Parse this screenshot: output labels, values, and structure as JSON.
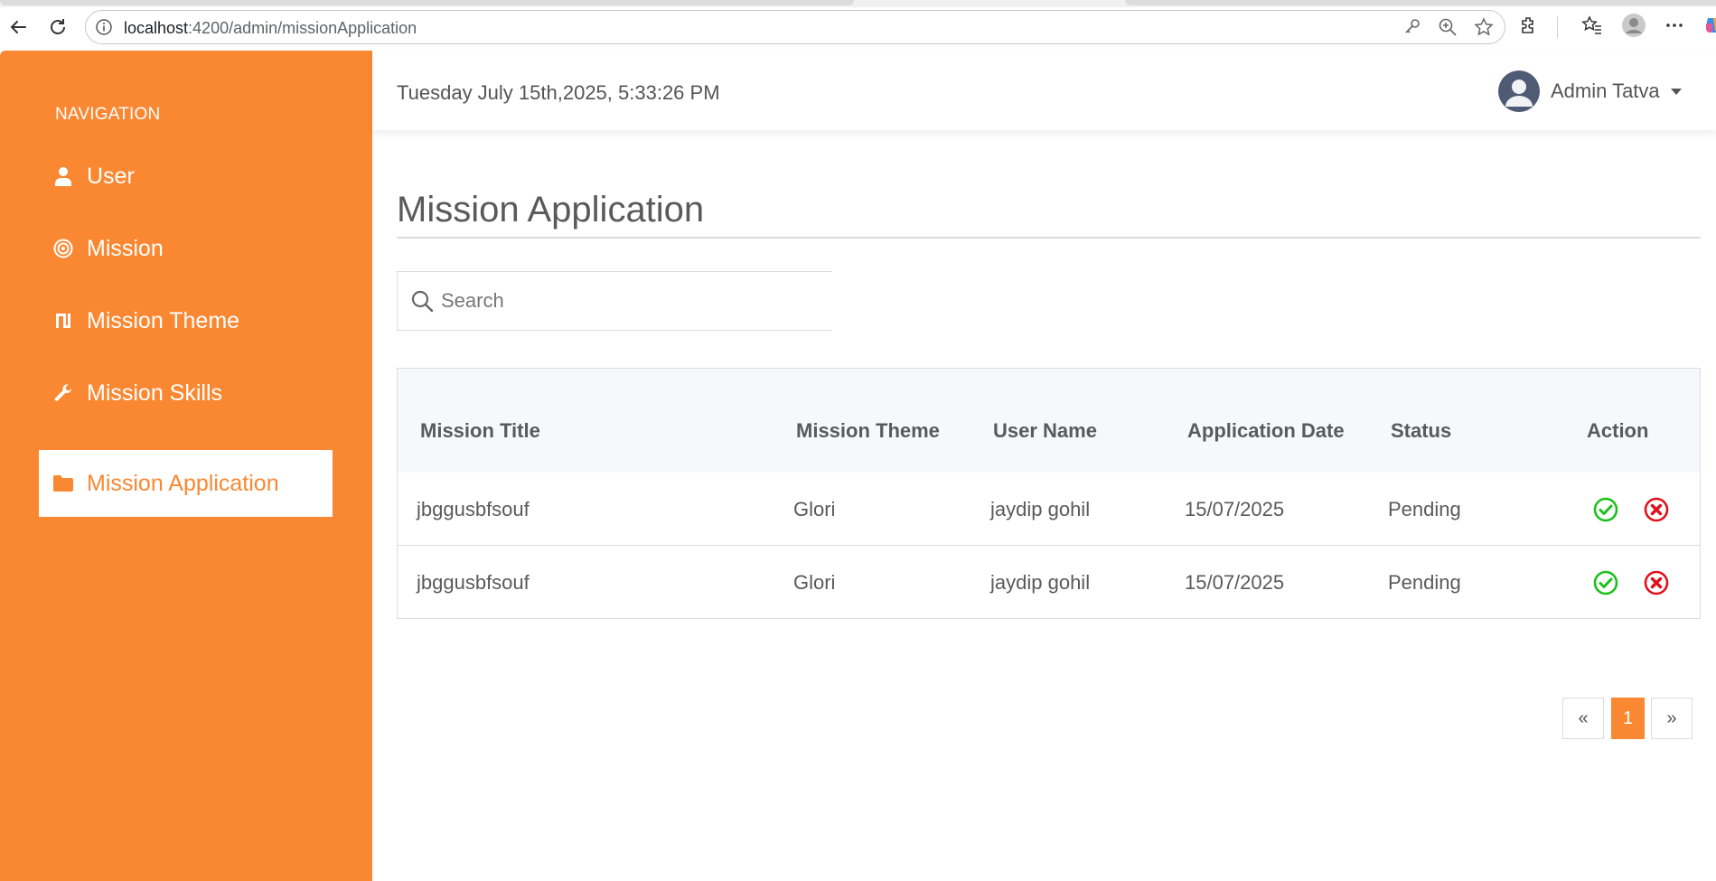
{
  "browser": {
    "url_host": "localhost",
    "url_path": ":4200/admin/missionApplication"
  },
  "sidebar": {
    "heading": "NAVIGATION",
    "items": [
      {
        "label": "User",
        "icon": "user-icon"
      },
      {
        "label": "Mission",
        "icon": "target-icon"
      },
      {
        "label": "Mission Theme",
        "icon": "theme-icon"
      },
      {
        "label": "Mission Skills",
        "icon": "wrench-icon"
      },
      {
        "label": "Mission Application",
        "icon": "folder-icon",
        "active": true
      }
    ]
  },
  "header": {
    "datetime": "Tuesday July 15th,2025, 5:33:26 PM",
    "user_name": "Admin Tatva"
  },
  "main": {
    "title": "Mission Application",
    "search_placeholder": "Search",
    "table": {
      "columns": [
        "Mission Title",
        "Mission Theme",
        "User Name",
        "Application Date",
        "Status",
        "Action"
      ],
      "rows": [
        {
          "title": "jbggusbfsouf",
          "theme": "Glori",
          "user": "jaydip gohil",
          "date": "15/07/2025",
          "status": "Pending"
        },
        {
          "title": "jbggusbfsouf",
          "theme": "Glori",
          "user": "jaydip gohil",
          "date": "15/07/2025",
          "status": "Pending"
        }
      ]
    },
    "pagination": {
      "prev": "«",
      "current": "1",
      "next": "»"
    }
  },
  "colors": {
    "accent": "#fa8832",
    "approve": "#1cc01c",
    "reject": "#e0101a"
  }
}
